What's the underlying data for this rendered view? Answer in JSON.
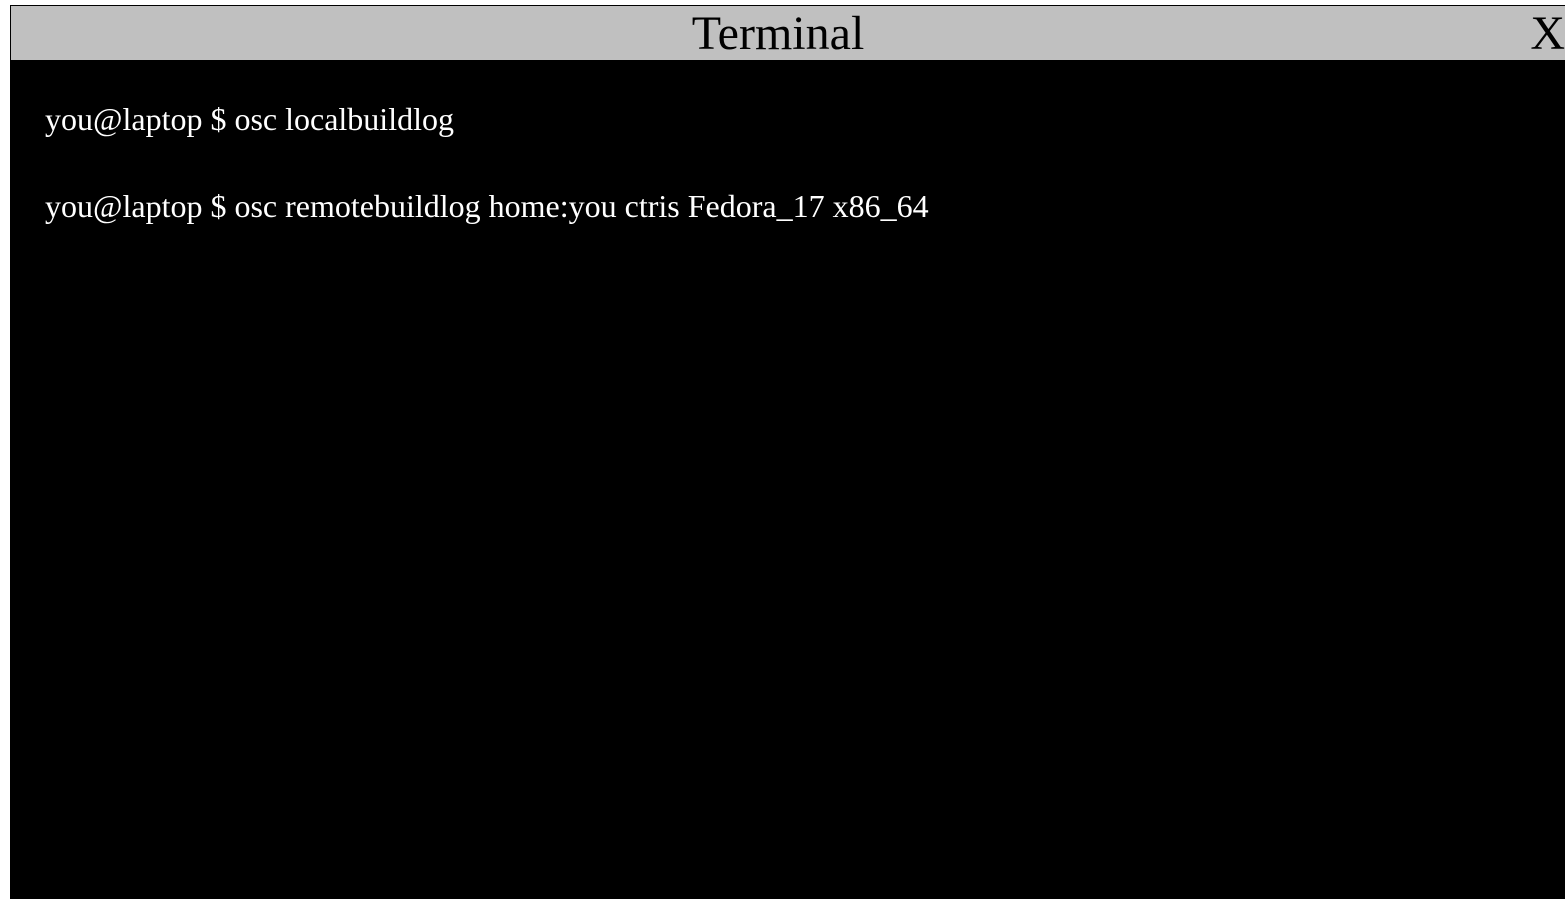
{
  "window": {
    "title": "Terminal",
    "close_label": "X"
  },
  "terminal": {
    "lines": [
      "you@laptop $ osc localbuildlog",
      "you@laptop $ osc remotebuildlog home:you ctris Fedora_17 x86_64"
    ]
  },
  "colors": {
    "titlebar_bg": "#c0c0c0",
    "terminal_bg": "#000000",
    "terminal_fg": "#ffffff"
  }
}
